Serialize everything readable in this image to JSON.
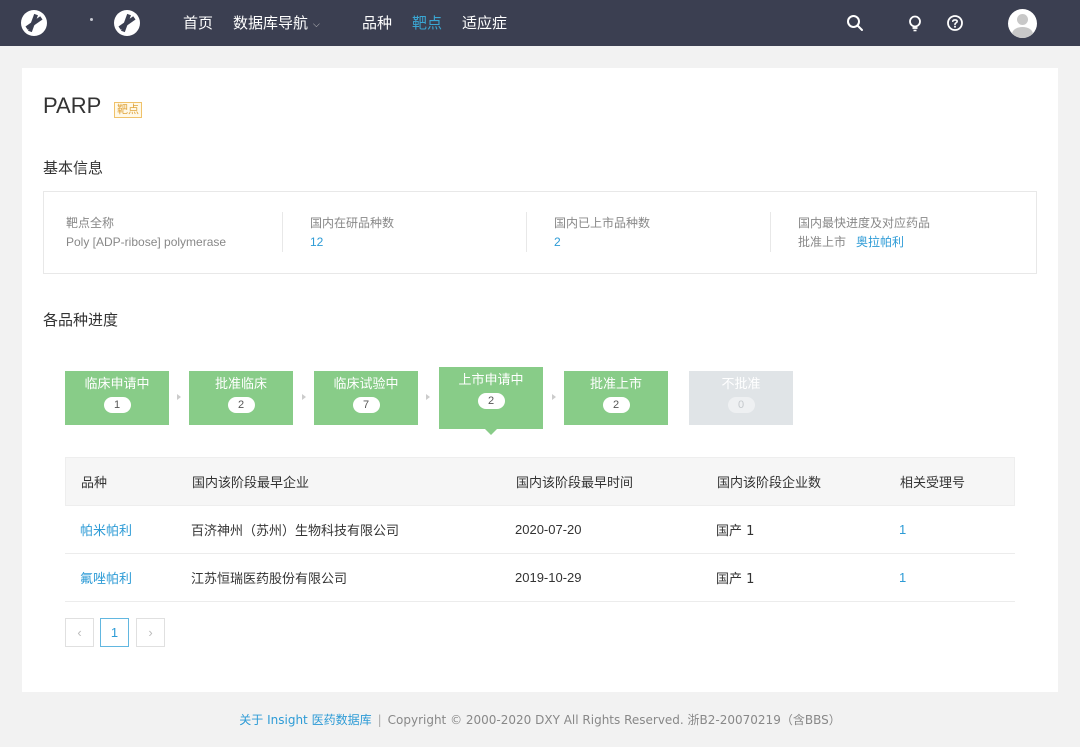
{
  "nav": {
    "items": [
      "首页",
      "数据库导航",
      "品种",
      "靶点",
      "适应症"
    ],
    "active_index": 3
  },
  "icons": [
    "logo-icon",
    "search-icon",
    "lightbulb-icon",
    "help-icon",
    "avatar-icon",
    "chevron-down-icon",
    "chevron-left-icon",
    "chevron-right-icon"
  ],
  "colors": {
    "nav_bg": "#3b3f51",
    "accent": "#2d9bd6",
    "stage_green": "#88cc88",
    "stage_disabled": "#e0e4e7",
    "tag_orange": "#e0a43c"
  },
  "page": {
    "title": "PARP",
    "tag": "靶点"
  },
  "basic_info": {
    "section_title": "基本信息",
    "full_name_label": "靶点全称",
    "full_name": "Poly [ADP-ribose] polymerase",
    "in_dev_label": "国内在研品种数",
    "in_dev": "12",
    "marketed_label": "国内已上市品种数",
    "marketed": "2",
    "fastest_label": "国内最快进度及对应药品",
    "fastest_stage": "批准上市",
    "fastest_drug": "奥拉帕利"
  },
  "progress": {
    "section_title": "各品种进度",
    "stages": [
      {
        "name": "临床申请中",
        "count": "1"
      },
      {
        "name": "批准临床",
        "count": "2"
      },
      {
        "name": "临床试验中",
        "count": "7"
      },
      {
        "name": "上市申请中",
        "count": "2"
      },
      {
        "name": "批准上市",
        "count": "2"
      },
      {
        "name": "不批准",
        "count": "0"
      }
    ],
    "active_stage": 3
  },
  "table": {
    "headers": [
      "品种",
      "国内该阶段最早企业",
      "国内该阶段最早时间",
      "国内该阶段企业数",
      "相关受理号"
    ],
    "rows": [
      [
        "帕米帕利",
        "百济神州（苏州）生物科技有限公司",
        "2020-07-20",
        "国产 1",
        "1"
      ],
      [
        "氟唑帕利",
        "江苏恒瑞医药股份有限公司",
        "2019-10-29",
        "国产 1",
        "1"
      ]
    ]
  },
  "pagination": {
    "prev": "‹",
    "current": "1",
    "next": "›"
  },
  "footer": {
    "about": "关于 Insight 医药数据库",
    "separator": "|",
    "copyright": "Copyright © 2000-2020 DXY All Rights Reserved. 浙B2-20070219（含BBS）"
  }
}
